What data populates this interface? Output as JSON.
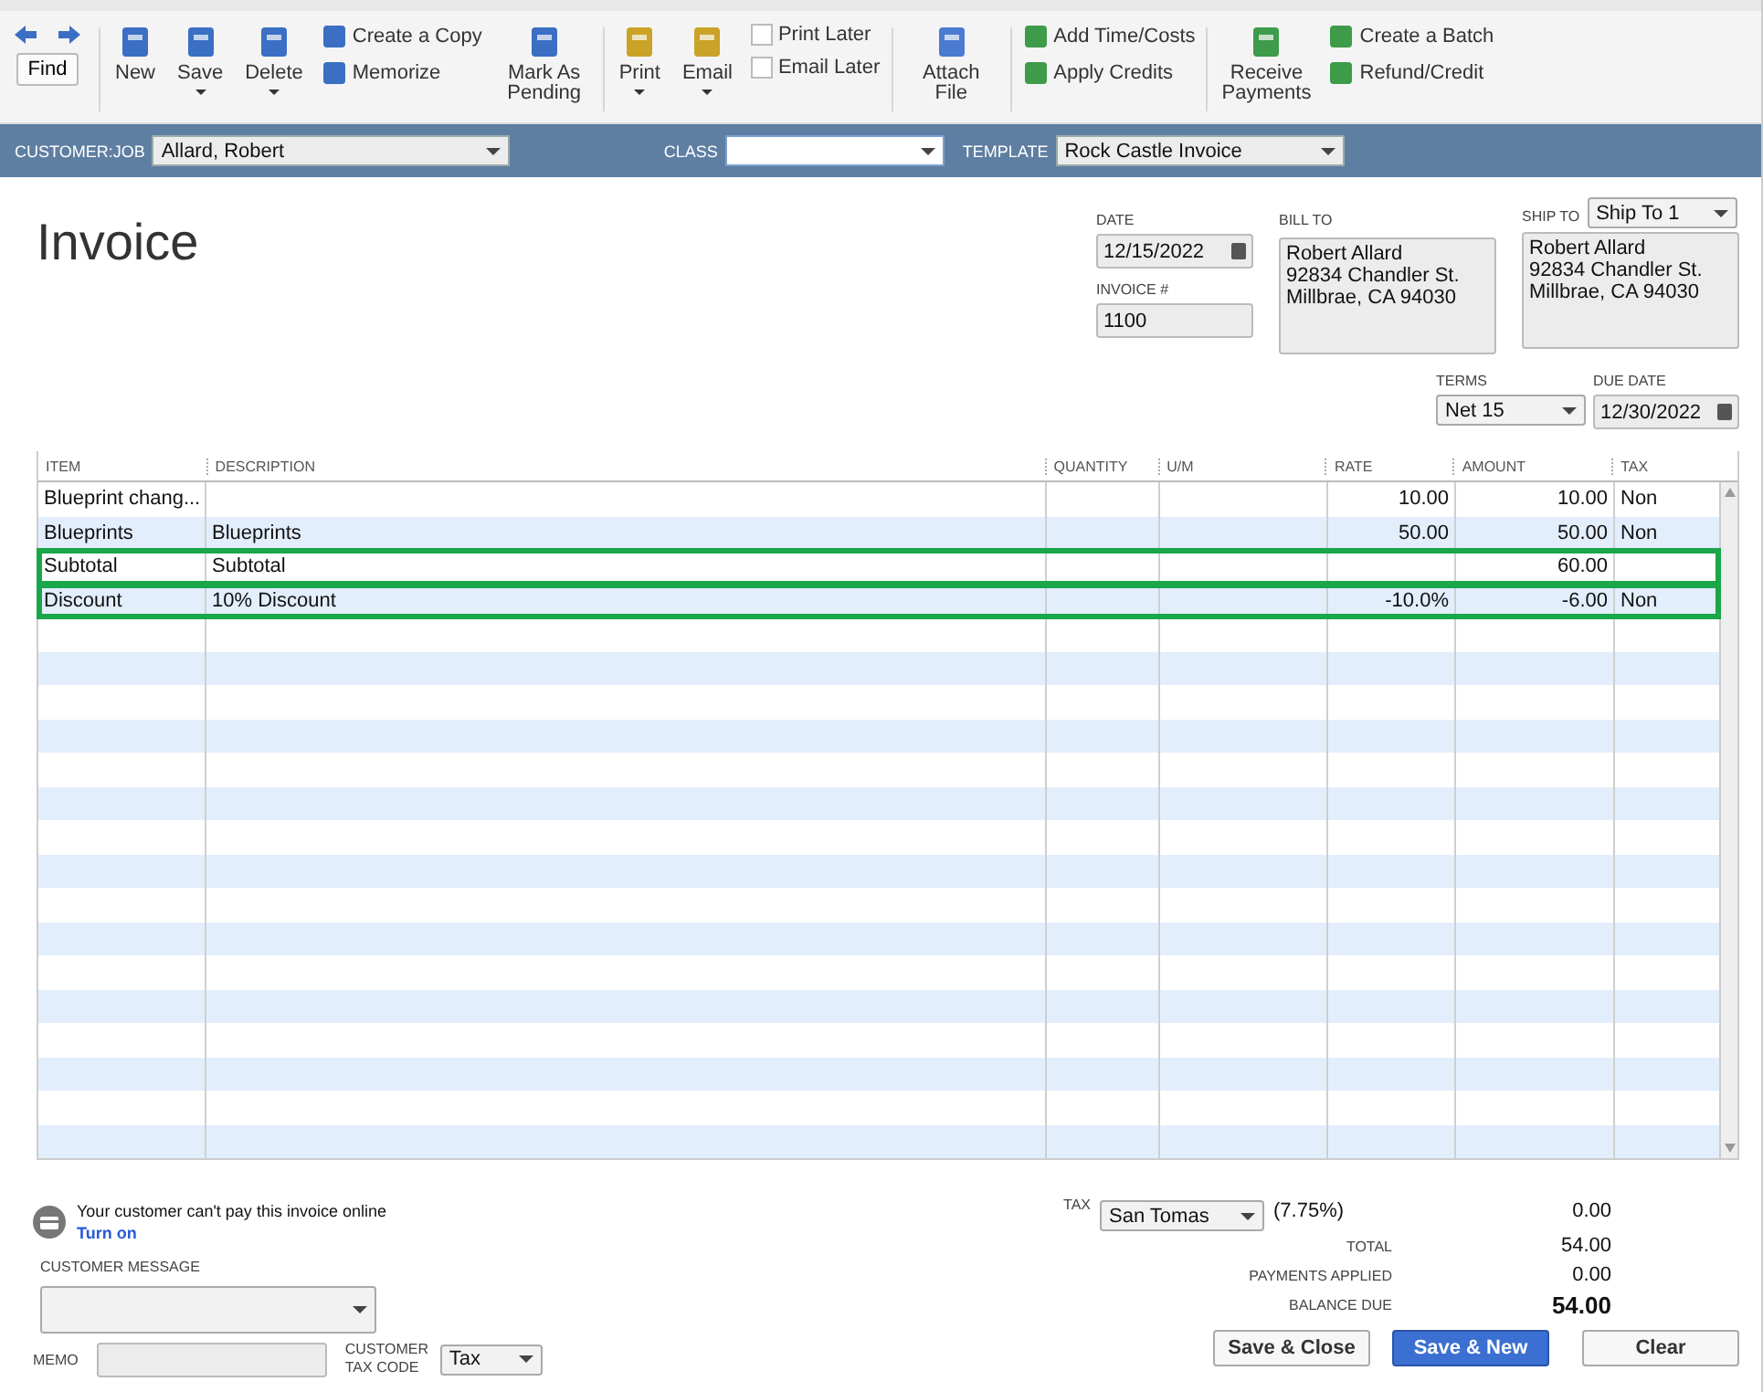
{
  "toolbar": {
    "find": "Find",
    "groups": [
      [
        {
          "kind": "big",
          "label": "New",
          "dropdown": false
        },
        {
          "kind": "big",
          "label": "Save",
          "dropdown": true
        },
        {
          "kind": "big",
          "label": "Delete",
          "dropdown": true
        },
        {
          "kind": "pair",
          "items": [
            {
              "label": "Create a Copy"
            },
            {
              "label": "Memorize"
            }
          ]
        },
        {
          "kind": "big",
          "label": "Mark As Pending",
          "dropdown": false
        }
      ],
      [
        {
          "kind": "big",
          "label": "Print",
          "dropdown": true
        },
        {
          "kind": "big",
          "label": "Email",
          "dropdown": true
        },
        {
          "kind": "checks",
          "items": [
            {
              "label": "Print Later",
              "checked": false
            },
            {
              "label": "Email Later",
              "checked": false
            }
          ]
        }
      ],
      [
        {
          "kind": "big",
          "label": "Attach File",
          "dropdown": false
        }
      ],
      [
        {
          "kind": "pair",
          "items": [
            {
              "label": "Add Time/Costs"
            },
            {
              "label": "Apply Credits"
            }
          ]
        }
      ],
      [
        {
          "kind": "big",
          "label": "Receive Payments",
          "dropdown": false
        },
        {
          "kind": "pair",
          "items": [
            {
              "label": "Create a Batch"
            },
            {
              "label": "Refund/Credit"
            }
          ]
        }
      ]
    ]
  },
  "header": {
    "customer_label": "CUSTOMER:JOB",
    "customer": "Allard, Robert",
    "class_label": "CLASS",
    "template_label": "TEMPLATE",
    "template": "Rock Castle Invoice"
  },
  "form": {
    "title": "Invoice",
    "date_label": "DATE",
    "date": "12/15/2022",
    "invoice_label": "INVOICE #",
    "invoice_no": "1100",
    "bill_to_label": "BILL TO",
    "bill_to": [
      "Robert Allard",
      "92834 Chandler St.",
      "Millbrae, CA 94030"
    ],
    "ship_to_label": "SHIP TO",
    "ship_to_select": "Ship To 1",
    "ship_to": [
      "Robert Allard",
      "92834 Chandler St.",
      "Millbrae, CA 94030"
    ],
    "terms_label": "TERMS",
    "terms": "Net 15",
    "due_label": "DUE DATE",
    "due_date": "12/30/2022"
  },
  "table": {
    "columns": [
      "ITEM",
      "DESCRIPTION",
      "QUANTITY",
      "U/M",
      "RATE",
      "AMOUNT",
      "TAX"
    ],
    "rows": [
      {
        "item": "Blueprint chang...",
        "description": "",
        "quantity": "",
        "um": "",
        "rate": "10.00",
        "amount": "10.00",
        "tax": "Non",
        "highlighted": false
      },
      {
        "item": "Blueprints",
        "description": "Blueprints",
        "quantity": "",
        "um": "",
        "rate": "50.00",
        "amount": "50.00",
        "tax": "Non",
        "highlighted": false
      },
      {
        "item": "Subtotal",
        "description": "Subtotal",
        "quantity": "",
        "um": "",
        "rate": "",
        "amount": "60.00",
        "tax": "",
        "highlighted": true
      },
      {
        "item": "Discount",
        "description": "10% Discount",
        "quantity": "",
        "um": "",
        "rate": "-10.0%",
        "amount": "-6.00",
        "tax": "Non",
        "highlighted": true
      }
    ]
  },
  "footer": {
    "online_notice": "Your customer can't pay this invoice online",
    "turn_on": "Turn on",
    "message_label": "CUSTOMER MESSAGE",
    "memo_label": "MEMO",
    "tax_code_label": "CUSTOMER TAX CODE",
    "tax_code": "Tax",
    "tax_label": "TAX",
    "tax_item": "San Tomas",
    "tax_rate": "(7.75%)",
    "tax_amount": "0.00",
    "total_label": "TOTAL",
    "total": "54.00",
    "payments_label": "PAYMENTS APPLIED",
    "payments": "0.00",
    "balance_label": "BALANCE DUE",
    "balance": "54.00"
  },
  "buttons": [
    {
      "label": "Save & Close",
      "primary": false
    },
    {
      "label": "Save & New",
      "primary": true
    },
    {
      "label": "Clear",
      "primary": false
    }
  ]
}
